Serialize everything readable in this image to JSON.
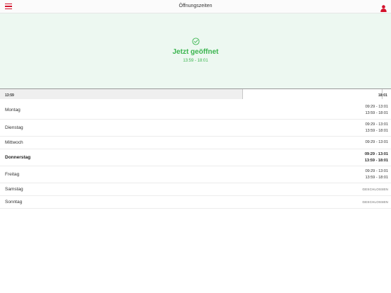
{
  "navbar": {
    "title": "Öffnungszeiten",
    "menu_icon": "hamburger-menu-icon",
    "user_icon": "user-icon",
    "accent_color": "#d3112b"
  },
  "status": {
    "icon": "check-circle-icon",
    "title": "Jetzt geöffnet",
    "times": "13:59 - 18:01",
    "color": "#3bb54f"
  },
  "timeline": {
    "start": "13:59",
    "end": "18:01",
    "progress": 0.62
  },
  "days": [
    {
      "name": "Montag",
      "times": [
        "09:29 - 13:01",
        "13:59 - 18:01"
      ],
      "current": false
    },
    {
      "name": "Dienstag",
      "times": [
        "09:29 - 13:01",
        "13:59 - 18:01"
      ],
      "current": false
    },
    {
      "name": "Mittwoch",
      "times": [
        "09:29 - 13:01"
      ],
      "current": false
    },
    {
      "name": "Donnerstag",
      "times": [
        "09:29 - 13:01",
        "13:59 - 18:01"
      ],
      "current": true
    },
    {
      "name": "Freitag",
      "times": [
        "09:29 - 13:01",
        "13:59 - 18:01"
      ],
      "current": false
    },
    {
      "name": "Samstag",
      "closed": "GESCHLOSSEN",
      "current": false
    },
    {
      "name": "Sonntag",
      "closed": "GESCHLOSSEN",
      "current": false
    }
  ]
}
